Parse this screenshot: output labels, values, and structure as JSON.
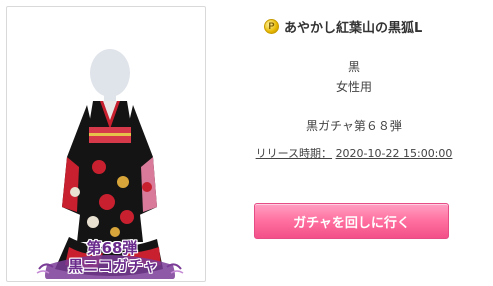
{
  "item": {
    "title": "あやかし紅葉山の黒狐L",
    "currency_icon": "P",
    "color": "黒",
    "gender": "女性用",
    "gacha_name": "黒ガチャ第６８弾",
    "release_label": "リリース時期：",
    "release_value": "2020-10-22 15:00:00"
  },
  "badge": {
    "line1": "第68弾",
    "line2": "黒ニコガチャ"
  },
  "button": {
    "label": "ガチャを回しに行く"
  },
  "colors": {
    "button_pink": "#ff6f9f",
    "kimono_black": "#141414",
    "kimono_red": "#c8202f",
    "badge_purple": "#6a2b8c"
  }
}
